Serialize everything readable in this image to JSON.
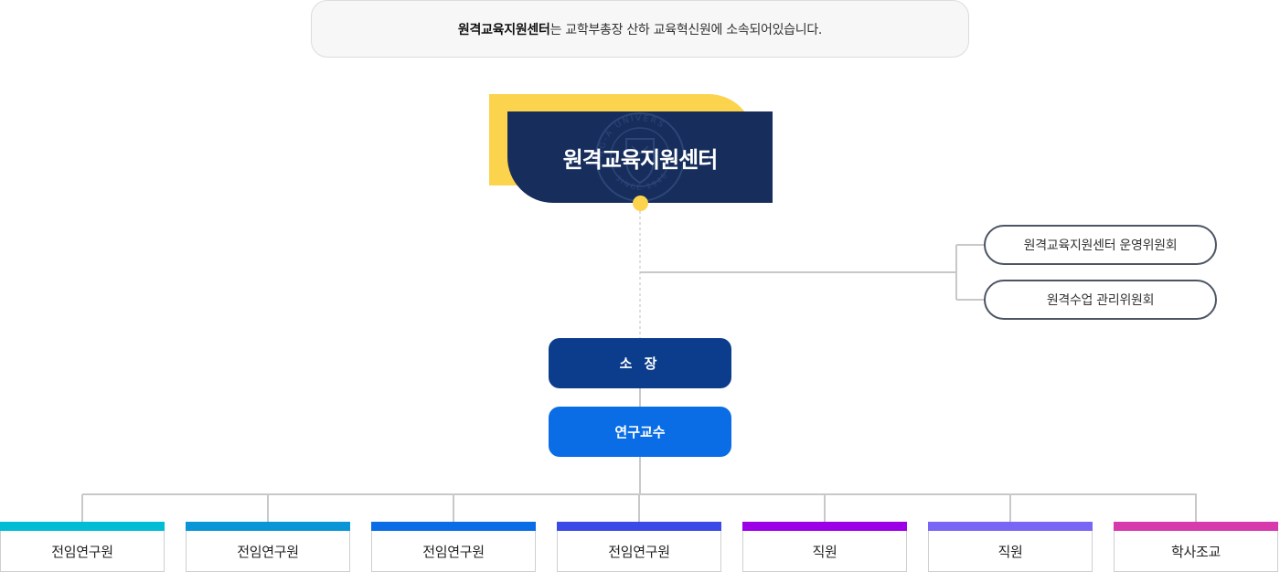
{
  "notice": {
    "bold": "원격교육지원센터",
    "rest": "는 교학부총장 산하 교육혁신원에 소속되어있습니다."
  },
  "title": "원격교육지원센터",
  "seal": {
    "top_text": "NG-A UNIVERS",
    "bottom_text": "SINCE 1946"
  },
  "committees": [
    {
      "label": "원격교육지원센터 운영위원회"
    },
    {
      "label": "원격수업 관리위원회"
    }
  ],
  "director": {
    "label": "소 장"
  },
  "professor": {
    "label": "연구교수"
  },
  "staff": [
    {
      "label": "전임연구원",
      "color": "#00bcd4"
    },
    {
      "label": "전임연구원",
      "color": "#0a96d6"
    },
    {
      "label": "전임연구원",
      "color": "#0a6de6"
    },
    {
      "label": "전임연구원",
      "color": "#3b4ae6"
    },
    {
      "label": "직원",
      "color": "#9b00e6"
    },
    {
      "label": "직원",
      "color": "#7a66f5"
    },
    {
      "label": "학사조교",
      "color": "#d63aad"
    }
  ],
  "colors": {
    "navy": "#172e5c",
    "yellow": "#fcd34d",
    "director": "#0b3d8c",
    "professor": "#0a6de6",
    "line": "#c8c8c8"
  }
}
